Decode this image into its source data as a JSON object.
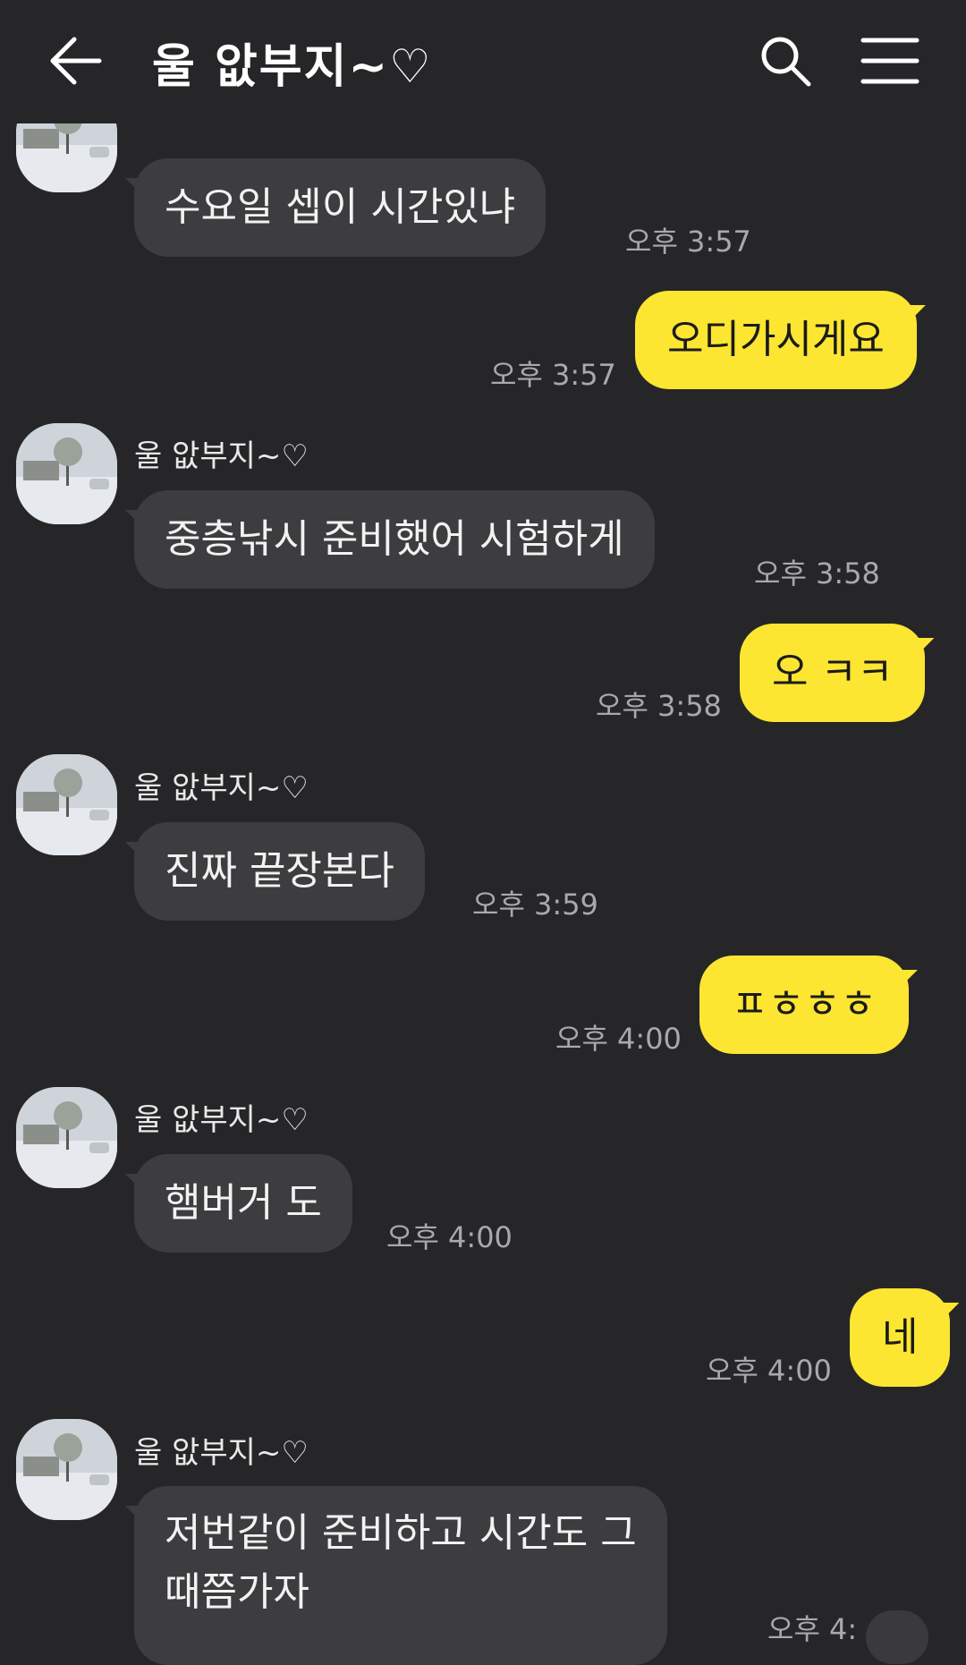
{
  "header": {
    "title": "울 앖부지~♡"
  },
  "messages": [
    {
      "type": "in",
      "text": "수요일 셉이 시간있냐",
      "time": "오후 3:57"
    },
    {
      "type": "out",
      "text": "오디가시게요",
      "time": "오후 3:57"
    },
    {
      "type": "in",
      "sender": "울 앖부지~♡",
      "text": "중층낚시 준비했어 시험하게",
      "time": "오후 3:58"
    },
    {
      "type": "out",
      "text": "오 ㅋㅋ",
      "time": "오후 3:58"
    },
    {
      "type": "in",
      "sender": "울 앖부지~♡",
      "text": "진짜 끝장본다",
      "time": "오후 3:59"
    },
    {
      "type": "out",
      "text": "ㅍㅎㅎㅎ",
      "time": "오후 4:00"
    },
    {
      "type": "in",
      "sender": "울 앖부지~♡",
      "text": "햄버거 도",
      "time": "오후 4:00"
    },
    {
      "type": "out",
      "text": "네",
      "time": "오후 4:00"
    },
    {
      "type": "in",
      "sender": "울 앖부지~♡",
      "text_line1": "저번같이 준비하고 시간도 그",
      "text_line2": "때쯤가자",
      "time": "오후 4:"
    }
  ],
  "colors": {
    "background": "#262628",
    "incoming_bubble": "#3d3d40",
    "outgoing_bubble": "#fde632",
    "timestamp": "#a9a9ad"
  }
}
